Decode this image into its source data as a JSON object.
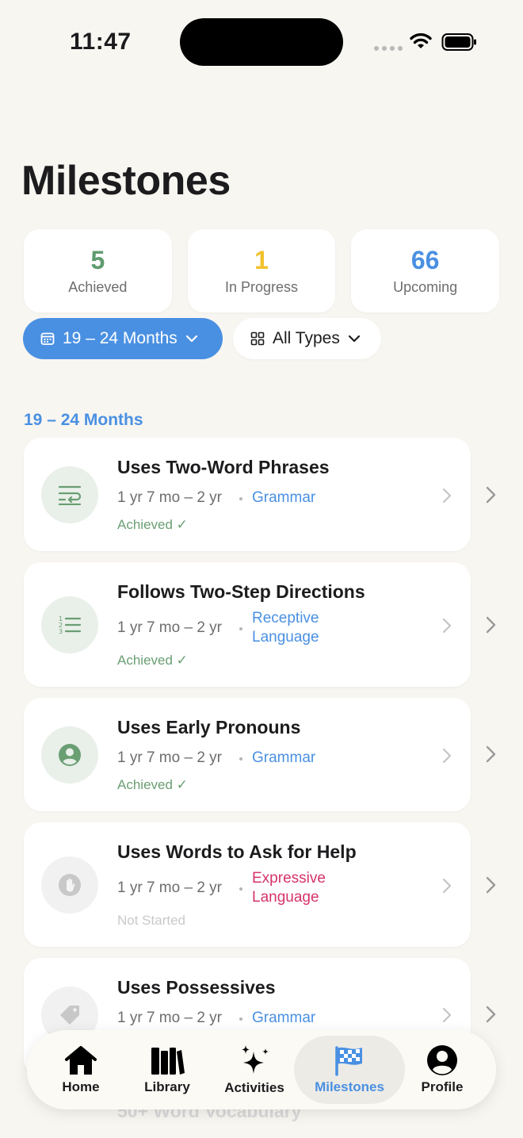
{
  "status_bar": {
    "time": "11:47"
  },
  "page": {
    "title": "Milestones"
  },
  "summary": [
    {
      "count": "5",
      "label": "Achieved",
      "color": "#5f9b6e"
    },
    {
      "count": "1",
      "label": "In Progress",
      "color": "#f2c12e"
    },
    {
      "count": "66",
      "label": "Upcoming",
      "color": "#4a90e2"
    }
  ],
  "filters": {
    "age": "19 – 24 Months",
    "type": "All Types"
  },
  "section": {
    "header": "19 – 24 Months"
  },
  "milestones": [
    {
      "title": "Uses Two-Word Phrases",
      "age": "1 yr 7 mo – 2 yr",
      "category": "Grammar",
      "category_color": "#4a90e2",
      "status": "Achieved ✓",
      "icon": "text-wrap-icon"
    },
    {
      "title": "Follows Two-Step Directions",
      "age": "1 yr 7 mo – 2 yr",
      "category_line1": "Receptive",
      "category_line2": "Language",
      "category_color": "#4a90e2",
      "status": "Achieved ✓",
      "icon": "numbered-list-icon"
    },
    {
      "title": "Uses Early Pronouns",
      "age": "1 yr 7 mo – 2 yr",
      "category": "Grammar",
      "category_color": "#4a90e2",
      "status": "Achieved ✓",
      "icon": "person-circle-icon"
    },
    {
      "title": "Uses Words to Ask for Help",
      "age": "1 yr 7 mo – 2 yr",
      "category_line1": "Expressive",
      "category_line2": "Language",
      "category_color": "#d6336c",
      "status": "Not Started",
      "icon": "raised-hand-icon"
    },
    {
      "title": "Uses Possessives",
      "age": "1 yr 7 mo – 2 yr",
      "category": "Grammar",
      "category_color": "#4a90e2",
      "status": "",
      "icon": "tag-icon"
    }
  ],
  "faded_next": "50+ Word Vocabulary",
  "tab_bar": {
    "home": "Home",
    "library": "Library",
    "activities": "Activities",
    "milestones": "Milestones",
    "profile": "Profile",
    "active_color": "#4a90e2"
  }
}
